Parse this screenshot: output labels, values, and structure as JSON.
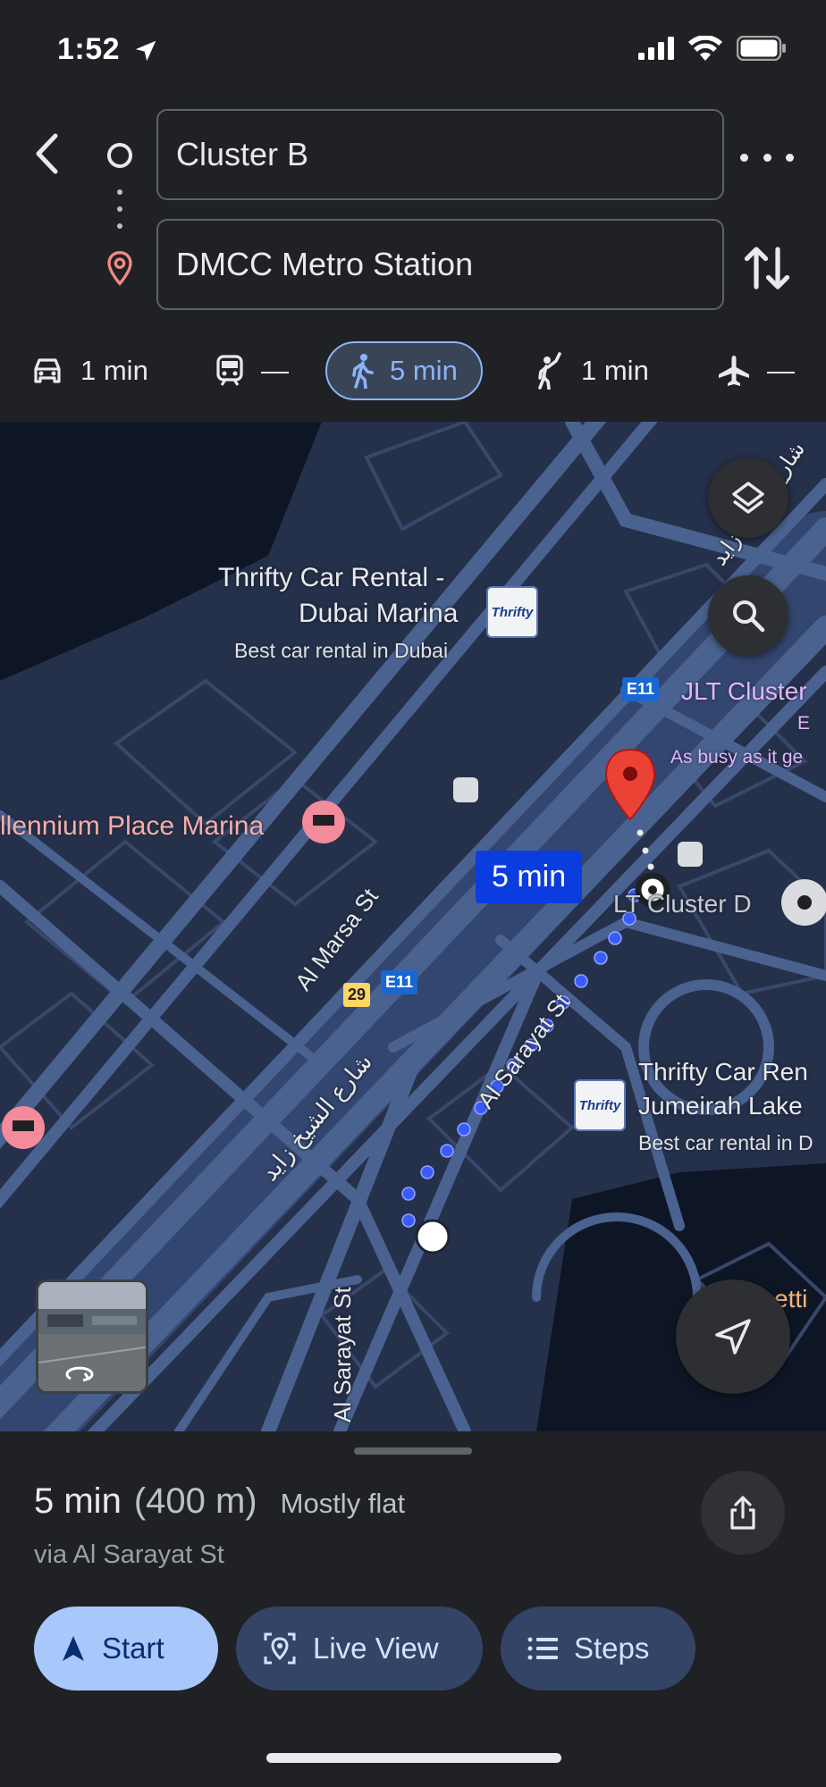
{
  "status": {
    "time": "1:52"
  },
  "search": {
    "origin": "Cluster B",
    "destination": "DMCC Metro Station"
  },
  "modes": [
    {
      "name": "drive",
      "label": "1 min",
      "icon": "car-icon"
    },
    {
      "name": "transit",
      "label": "—",
      "icon": "train-icon"
    },
    {
      "name": "walk",
      "label": "5 min",
      "icon": "walk-icon",
      "active": true
    },
    {
      "name": "ride",
      "label": "1 min",
      "icon": "rideshare-icon"
    },
    {
      "name": "flight",
      "label": "—",
      "icon": "plane-icon"
    }
  ],
  "map": {
    "route_time": "5 min",
    "places": {
      "thrifty_marina_line1": "Thrifty Car Rental -",
      "thrifty_marina_line2": "Dubai Marina",
      "thrifty_marina_sub": "Best car rental in Dubai",
      "millennium": "llennium Place Marina",
      "jlt_cluster_e": "JLT Cluster",
      "jlt_cluster_e_sub1": "E ",
      "jlt_cluster_e_sub2": "As busy as it ge",
      "cluster_d": "LT Cluster D",
      "thrifty_jlt_line1": "Thrifty Car Ren",
      "thrifty_jlt_line2": "Jumeirah Lake",
      "thrifty_jlt_sub": "Best car rental in D",
      "partial_right": "etti"
    },
    "streets": {
      "al_marsa": "Al Marsa St",
      "al_sarayat": "Al Sarayat St",
      "al_sarayat_2": "Al Sarayat St",
      "sheikh_zayed_ar": "شارع الشيخ زايد",
      "sheikh_zayed_ar_top": "شارع الشيخ زايد"
    },
    "badges": {
      "e11_a": "E11",
      "e11_b": "E11",
      "route29": "29"
    },
    "thrifty_logo": "Thrifty"
  },
  "summary": {
    "time": "5 min",
    "distance": "(400 m)",
    "terrain": "Mostly flat",
    "via": "via Al Sarayat St"
  },
  "actions": {
    "start": "Start",
    "live_view": "Live View",
    "steps": "Steps"
  },
  "colors": {
    "route": "#3b5bff",
    "accent": "#8ab4f8",
    "pin": "#ea4335"
  }
}
